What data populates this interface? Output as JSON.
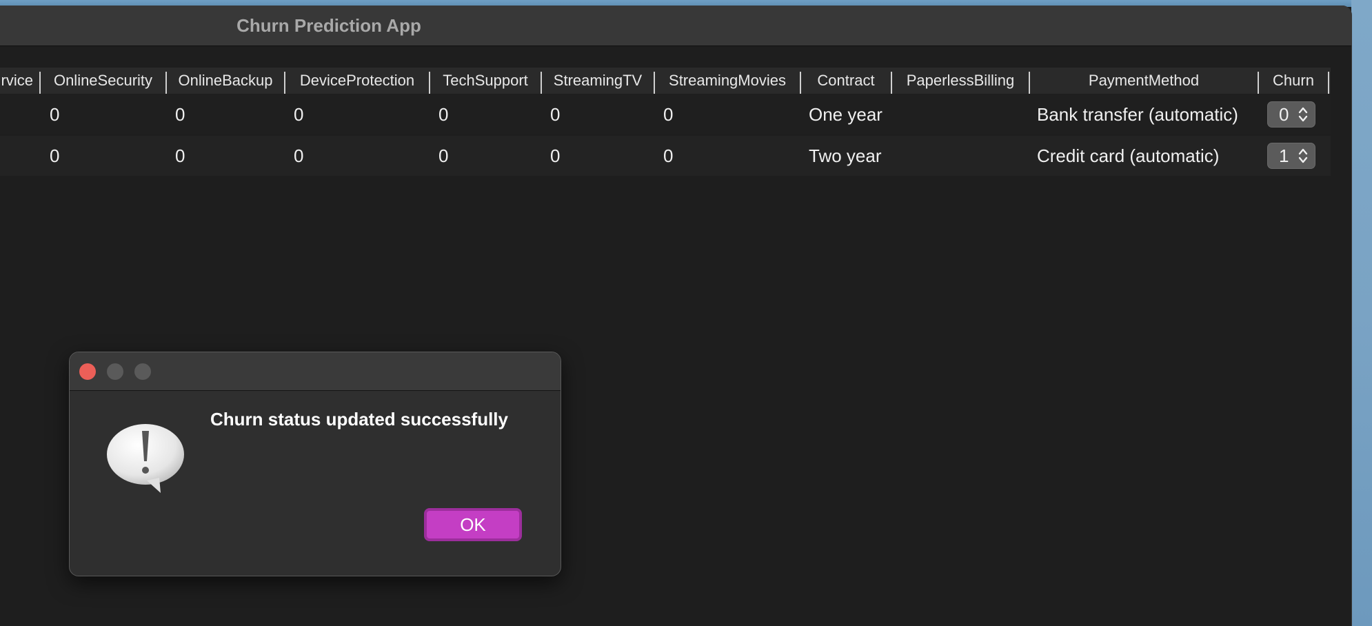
{
  "window": {
    "title": "Churn Prediction App"
  },
  "table": {
    "columns": [
      {
        "label": "rvice"
      },
      {
        "label": "OnlineSecurity"
      },
      {
        "label": "OnlineBackup"
      },
      {
        "label": "DeviceProtection"
      },
      {
        "label": "TechSupport"
      },
      {
        "label": "StreamingTV"
      },
      {
        "label": "StreamingMovies"
      },
      {
        "label": "Contract"
      },
      {
        "label": "PaperlessBilling"
      },
      {
        "label": "PaymentMethod"
      },
      {
        "label": "Churn"
      }
    ],
    "rows": [
      {
        "online_security": "0",
        "online_backup": "0",
        "device_protection": "0",
        "tech_support": "0",
        "streaming_tv": "0",
        "streaming_movies": "0",
        "contract": "One year",
        "paperless_billing": "",
        "payment_method": "Bank transfer (automatic)",
        "churn": "0"
      },
      {
        "online_security": "0",
        "online_backup": "0",
        "device_protection": "0",
        "tech_support": "0",
        "streaming_tv": "0",
        "streaming_movies": "0",
        "contract": "Two year",
        "paperless_billing": "",
        "payment_method": "Credit card (automatic)",
        "churn": "1"
      }
    ]
  },
  "dialog": {
    "message": "Churn status updated successfully",
    "ok_label": "OK",
    "icon": "alert-exclamation-icon"
  },
  "colors": {
    "ok_button": "#c43ec4",
    "close_light": "#ec5f58"
  }
}
